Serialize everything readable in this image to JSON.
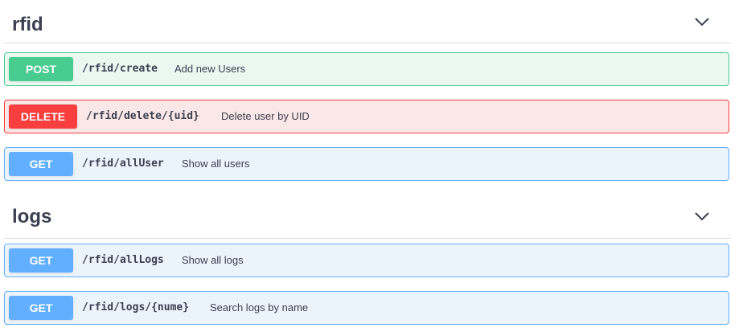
{
  "sections": [
    {
      "title": "rfid",
      "operations": [
        {
          "method": "POST",
          "path": "/rfid/create",
          "description": "Add new Users"
        },
        {
          "method": "DELETE",
          "path": "/rfid/delete/{uid}",
          "description": "Delete user by UID"
        },
        {
          "method": "GET",
          "path": "/rfid/allUser",
          "description": "Show all users"
        }
      ]
    },
    {
      "title": "logs",
      "operations": [
        {
          "method": "GET",
          "path": "/rfid/allLogs",
          "description": "Show all logs"
        },
        {
          "method": "GET",
          "path": "/rfid/logs/{nume}",
          "description": "Search logs by name"
        }
      ]
    }
  ],
  "icons": {
    "collapse": "chevron-down-icon"
  },
  "colors": {
    "post": "#49cc90",
    "delete": "#f93e3e",
    "get": "#61affe",
    "text": "#3b4151"
  }
}
